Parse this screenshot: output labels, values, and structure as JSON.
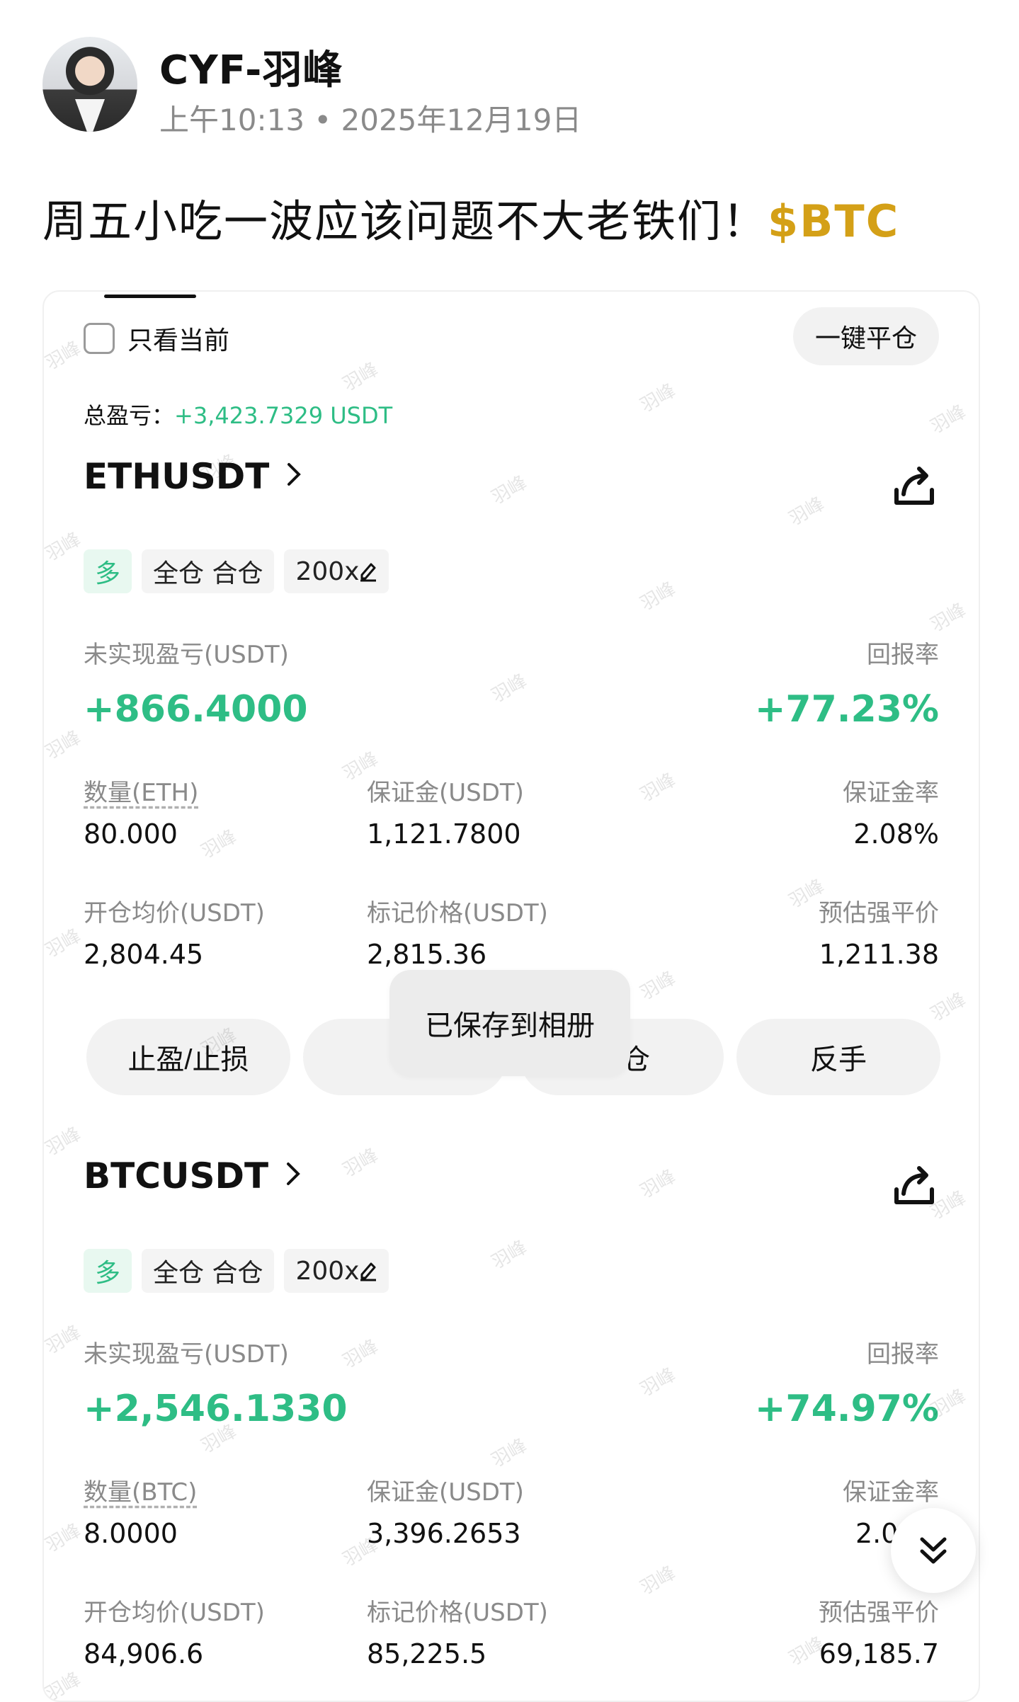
{
  "post": {
    "author": "CYF-羽峰",
    "meta": "上午10:13 • 2025年12月19日",
    "text": "周五小吃一波应该问题不大老铁们！",
    "ticker": "$BTC"
  },
  "panel": {
    "only_current_label": "只看当前",
    "close_all_label": "一键平仓",
    "total_pnl_label": "总盈亏：",
    "total_pnl_value": "+3,423.7329 USDT"
  },
  "positions": [
    {
      "symbol": "ETHUSDT",
      "tags": {
        "side": "多",
        "margin_mode": "全仓 合仓",
        "leverage": "200x"
      },
      "unrealized_label": "未实现盈亏(USDT)",
      "unrealized_value": "+866.4000",
      "roe_label": "回报率",
      "roe_value": "+77.23%",
      "qty_label": "数量(ETH)",
      "qty_value": "80.000",
      "margin_label": "保证金(USDT)",
      "margin_value": "1,121.7800",
      "margin_ratio_label": "保证金率",
      "margin_ratio_value": "2.08%",
      "entry_label": "开仓均价(USDT)",
      "entry_value": "2,804.45",
      "mark_label": "标记价格(USDT)",
      "mark_value": "2,815.36",
      "liq_label": "预估强平价",
      "liq_value": "1,211.38"
    },
    {
      "symbol": "BTCUSDT",
      "tags": {
        "side": "多",
        "margin_mode": "全仓 合仓",
        "leverage": "200x"
      },
      "unrealized_label": "未实现盈亏(USDT)",
      "unrealized_value": "+2,546.1330",
      "roe_label": "回报率",
      "roe_value": "+74.97%",
      "qty_label": "数量(BTC)",
      "qty_value": "8.0000",
      "margin_label": "保证金(USDT)",
      "margin_value": "3,396.2653",
      "margin_ratio_label": "保证金率",
      "margin_ratio_value": "2.0",
      "entry_label": "开仓均价(USDT)",
      "entry_value": "84,906.6",
      "mark_label": "标记价格(USDT)",
      "mark_value": "85,225.5",
      "liq_label": "预估强平价",
      "liq_value": "69,185.7"
    }
  ],
  "actions": {
    "tp_sl": "止盈/止损",
    "close_1": "平",
    "close_2": "平仓",
    "reverse": "反手"
  },
  "toast": "已保存到相册",
  "watermark": "羽峰",
  "colors": {
    "profit_green": "#2ebd85",
    "ticker_gold": "#d4a017"
  },
  "icons": [
    "share-icon",
    "chevron-right-icon",
    "edit-icon",
    "double-chevron-down-icon"
  ]
}
